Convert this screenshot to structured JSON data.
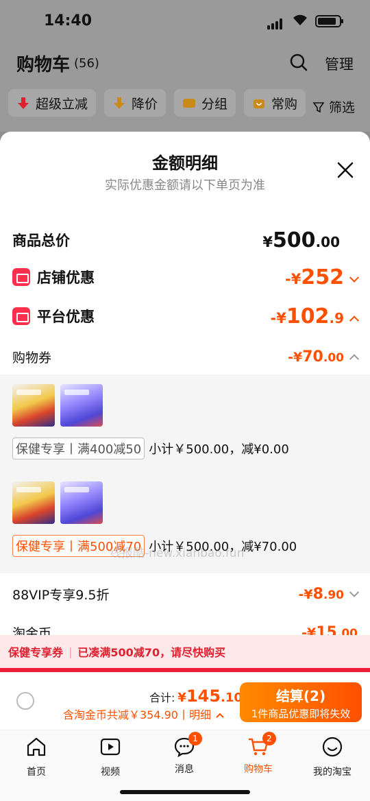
{
  "status": {
    "time": "14:40"
  },
  "header": {
    "title": "购物车",
    "count": "(56)",
    "manage": "管理",
    "chips": [
      "超级立减",
      "降价",
      "分组",
      "常购"
    ],
    "filter": "筛选"
  },
  "sheet": {
    "title": "金额明细",
    "subtitle": "实际优惠金额请以下单页为准",
    "goods_total": {
      "label": "商品总价",
      "currency": "¥",
      "int": "500",
      "dec": ".00"
    },
    "store_discount": {
      "label": "店铺优惠",
      "prefix": "-¥",
      "int": "252",
      "dec": ""
    },
    "platform_discount": {
      "label": "平台优惠",
      "prefix": "-¥",
      "int": "102",
      "dec": ".9"
    },
    "coupon": {
      "label": "购物券",
      "prefix": "-¥",
      "int": "70",
      "dec": ".00"
    },
    "coupon_groups": [
      {
        "tag": "保健专享丨满400减50",
        "subtotal": "小计￥500.00，减¥0.00"
      },
      {
        "tag": "保健专享丨满500减70",
        "subtotal": "小计￥500.00，减¥70.00"
      }
    ],
    "vip": {
      "label": "88VIP专享9.5折",
      "prefix": "-¥",
      "int": "8",
      "dec": ".90"
    },
    "taojinbi": {
      "label": "淘金币",
      "prefix": "-¥",
      "int": "15",
      "dec": ".00"
    },
    "watermark": "线报酷-new.xianbao.fun"
  },
  "banner": {
    "left": "保健专享券",
    "right": "已凑满500减70，请尽快购买"
  },
  "bottom": {
    "total_label": "合计:",
    "currency": "¥",
    "total_int": "145",
    "total_dec": ".10",
    "saving": "含淘金币共减￥354.90丨明细",
    "checkout": "结算(2)",
    "checkout_sub": "1件商品优惠即将失效"
  },
  "tabs": [
    {
      "label": "首页",
      "badge": ""
    },
    {
      "label": "视频",
      "badge": ""
    },
    {
      "label": "消息",
      "badge": "1"
    },
    {
      "label": "购物车",
      "badge": "2"
    },
    {
      "label": "我的淘宝",
      "badge": ""
    }
  ],
  "colors": {
    "accent": "#ff5000",
    "red": "#ee1e3a"
  }
}
